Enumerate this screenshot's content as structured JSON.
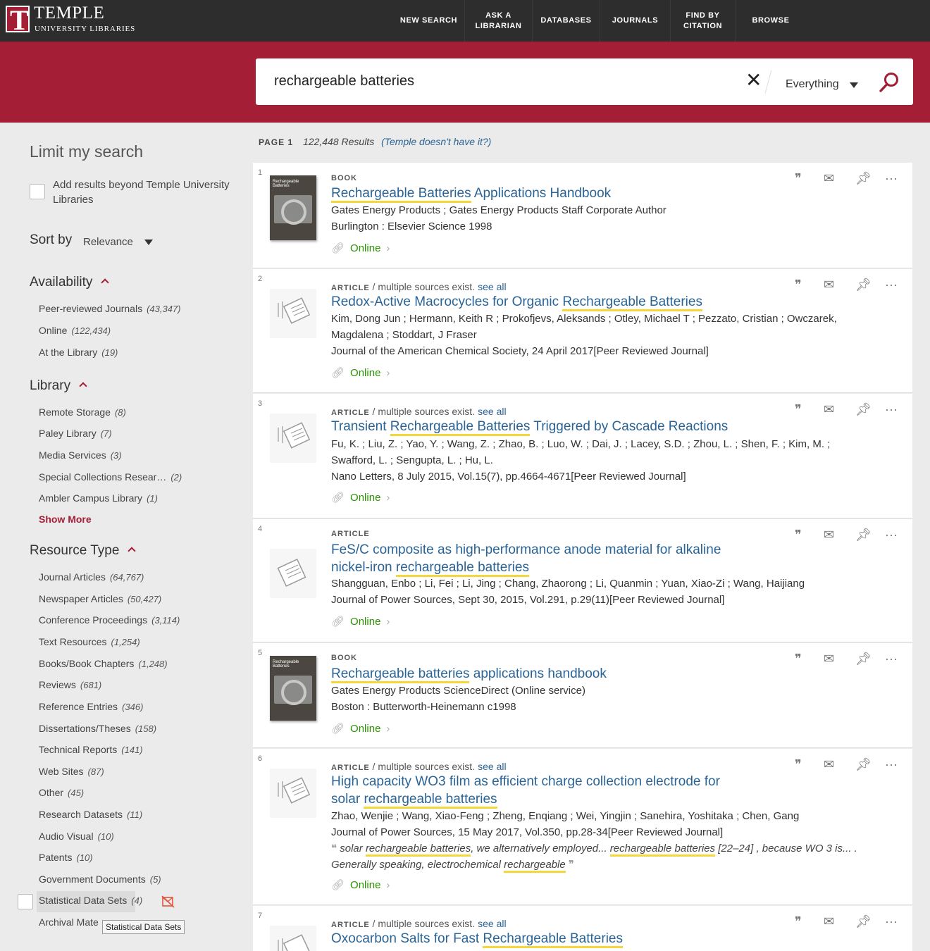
{
  "header": {
    "logo_name": "TEMPLE",
    "logo_sub": "UNIVERSITY LIBRARIES",
    "logo_mark": "T",
    "nav": [
      {
        "line1": "NEW SEARCH",
        "line2": ""
      },
      {
        "line1": "ASK A",
        "line2": "LIBRARIAN"
      },
      {
        "line1": "DATABASES",
        "line2": ""
      },
      {
        "line1": "JOURNALS",
        "line2": ""
      },
      {
        "line1": "FIND BY",
        "line2": "CITATION"
      },
      {
        "line1": "BROWSE",
        "line2": ""
      }
    ]
  },
  "search": {
    "query": "rechargeable batteries",
    "scope": "Everything"
  },
  "sidebar": {
    "title": "Limit my search",
    "beyond_label": "Add results beyond Temple University Libraries",
    "sort_label": "Sort by",
    "sort_value": "Relevance",
    "availability": {
      "title": "Availability",
      "items": [
        {
          "label": "Peer-reviewed Journals",
          "count": "(43,347)"
        },
        {
          "label": "Online",
          "count": "(122,434)"
        },
        {
          "label": "At the Library",
          "count": "(19)"
        }
      ]
    },
    "library": {
      "title": "Library",
      "items": [
        {
          "label": "Remote Storage",
          "count": "(8)"
        },
        {
          "label": "Paley Library",
          "count": "(7)"
        },
        {
          "label": "Media Services",
          "count": "(3)"
        },
        {
          "label": "Special Collections Resear…",
          "count": "(2)"
        },
        {
          "label": "Ambler Campus Library",
          "count": "(1)"
        }
      ],
      "show_more": "Show More"
    },
    "resource_type": {
      "title": "Resource Type",
      "items": [
        {
          "label": "Journal Articles",
          "count": "(64,767)"
        },
        {
          "label": "Newspaper Articles",
          "count": "(50,427)"
        },
        {
          "label": "Conference Proceedings",
          "count": "(3,114)"
        },
        {
          "label": "Text Resources",
          "count": "(1,254)"
        },
        {
          "label": "Books/Book Chapters",
          "count": "(1,248)"
        },
        {
          "label": "Reviews",
          "count": "(681)"
        },
        {
          "label": "Reference Entries",
          "count": "(346)"
        },
        {
          "label": "Dissertations/Theses",
          "count": "(158)"
        },
        {
          "label": "Technical Reports",
          "count": "(141)"
        },
        {
          "label": "Web Sites",
          "count": "(87)"
        },
        {
          "label": "Other",
          "count": "(45)"
        },
        {
          "label": "Research Datasets",
          "count": "(11)"
        },
        {
          "label": "Audio Visual",
          "count": "(10)"
        },
        {
          "label": "Patents",
          "count": "(10)"
        },
        {
          "label": "Government Documents",
          "count": "(5)"
        },
        {
          "label": "Statistical Data Sets",
          "count": "(4)"
        },
        {
          "label": "Archival Mate",
          "count": ""
        }
      ]
    },
    "tooltip": "Statistical Data Sets"
  },
  "results_bar": {
    "page": "PAGE 1",
    "count": "122,448 Results",
    "link": "(Temple doesn't have it?)"
  },
  "results": [
    {
      "num": "1",
      "type": "BOOK",
      "multi": "",
      "see_all": "",
      "title_hl": "Rechargeable Batteries",
      "title_rest": " Applications Handbook",
      "line1": "Gates Energy Products ; Gates Energy Products Staff Corporate Author",
      "line2": "Burlington : Elsevier Science 1998",
      "online": "Online"
    },
    {
      "num": "2",
      "type": "ARTICLE",
      "multi": " / multiple sources exist.",
      "see_all": "see all",
      "title_pre": "Redox-Active Macrocycles for Organic ",
      "title_hl": "Rechargeable Batteries",
      "line1": "Kim, Dong Jun ; Hermann, Keith R ; Prokofjevs, Aleksands ; Otley, Michael T ; Pezzato, Cristian ; Owczarek, Magdalena ; Stoddart, J Fraser",
      "line2": "Journal of the American Chemical Society, 24 April 2017[Peer Reviewed Journal]",
      "online": "Online"
    },
    {
      "num": "3",
      "type": "ARTICLE",
      "multi": " / multiple sources exist.",
      "see_all": "see all",
      "title_pre": "Transient ",
      "title_hl": "Rechargeable Batteries",
      "title_rest": " Triggered by Cascade Reactions",
      "line1": "Fu, K. ; Liu, Z. ; Yao, Y. ; Wang, Z. ; Zhao, B. ; Luo, W. ; Dai, J. ; Lacey, S.D. ; Zhou, L. ; Shen, F. ; Kim, M. ; Swafford, L. ; Sengupta, L. ; Hu, L.",
      "line2": "Nano Letters, 8 July 2015, Vol.15(7), pp.4664-4671[Peer Reviewed Journal]",
      "online": "Online"
    },
    {
      "num": "4",
      "type": "ARTICLE",
      "multi": "",
      "see_all": "",
      "title_pre": "FeS/C composite as high-performance anode material for alkaline nickel-iron ",
      "title_hl": "rechargeable batteries",
      "line1": "Shangguan, Enbo ; Li, Fei ; Li, Jing ; Chang, Zhaorong ; Li, Quanmin ; Yuan, Xiao-Zi ; Wang, Haijiang",
      "line2": "Journal of Power Sources, Sept 30, 2015, Vol.291, p.29(11)[Peer Reviewed Journal]",
      "online": "Online"
    },
    {
      "num": "5",
      "type": "BOOK",
      "multi": "",
      "see_all": "",
      "title_hl": "Rechargeable batteries",
      "title_rest": " applications handbook",
      "line1": "Gates Energy Products ScienceDirect (Online service)",
      "line2": "Boston : Butterworth-Heinemann c1998",
      "online": "Online"
    },
    {
      "num": "6",
      "type": "ARTICLE",
      "multi": " / multiple sources exist.",
      "see_all": "see all",
      "title_pre": "High capacity WO3 film as efficient charge collection electrode for solar ",
      "title_hl": "rechargeable batteries",
      "line1": "Zhao, Wenjie ; Wang, Xiao-Feng ; Zheng, Enqiang ; Wei, Yingjin ; Sanehira, Yoshitaka ; Chen, Gang",
      "line2": "Journal of Power Sources, 15 May 2017, Vol.350, pp.28-34[Peer Reviewed Journal]",
      "snip_a": "solar ",
      "snip_b": "rechargeable batteries",
      "snip_c": ", we alternatively employed... ",
      "snip_d": "rechargeable batteries",
      "snip_e": " [22–24] , because WO 3 is... . Generally speaking, electrochemical ",
      "snip_f": "rechargeable",
      "online": "Online"
    },
    {
      "num": "7",
      "type": "ARTICLE",
      "multi": " / multiple sources exist.",
      "see_all": "see all",
      "title_pre": "Oxocarbon Salts for Fast ",
      "title_hl": "Rechargeable Batteries"
    }
  ],
  "icons": {
    "cite": "quote-icon",
    "email": "envelope-icon",
    "pin": "pin-icon",
    "more": "more-icon"
  },
  "colors": {
    "brand": "#a41e35",
    "link": "#2a6496",
    "online": "#2b9200",
    "highlight": "#f4d73b"
  }
}
